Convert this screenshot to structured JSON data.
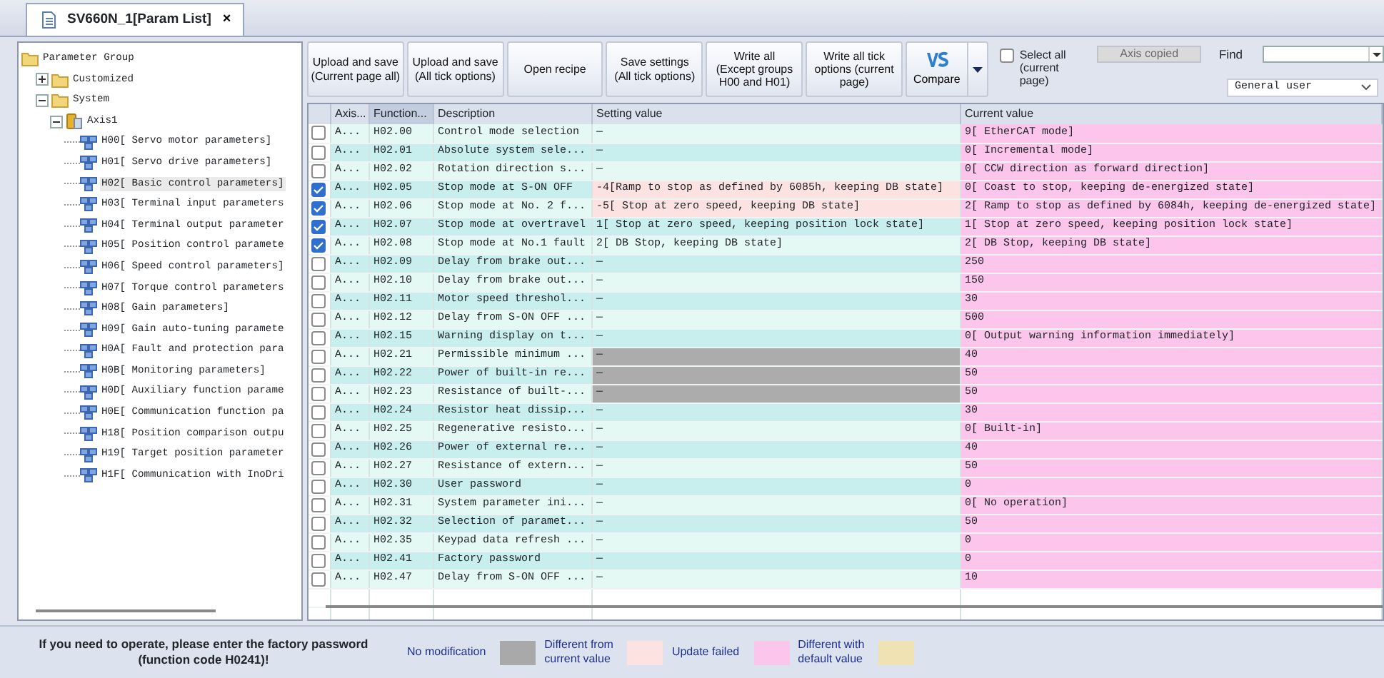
{
  "tab": {
    "title": "SV660N_1[Param List]",
    "close": "×"
  },
  "tree": [
    {
      "label": "Parameter Group",
      "kind": "folder",
      "children": [
        {
          "label": "Customized",
          "kind": "folder",
          "expanded": false
        },
        {
          "label": "System",
          "kind": "folder",
          "expanded": true,
          "children": [
            {
              "label": "Axis1",
              "kind": "axis",
              "expanded": true,
              "children": [
                {
                  "label": "H00[ Servo motor parameters]",
                  "kind": "group",
                  "selected": false
                },
                {
                  "label": "H01[ Servo drive parameters]",
                  "kind": "group",
                  "selected": false
                },
                {
                  "label": "H02[ Basic control parameters]",
                  "kind": "group",
                  "selected": true
                },
                {
                  "label": "H03[ Terminal input parameters",
                  "kind": "group",
                  "selected": false
                },
                {
                  "label": "H04[ Terminal output parameter",
                  "kind": "group",
                  "selected": false
                },
                {
                  "label": "H05[ Position control paramete",
                  "kind": "group",
                  "selected": false
                },
                {
                  "label": "H06[ Speed control parameters]",
                  "kind": "group",
                  "selected": false
                },
                {
                  "label": "H07[ Torque control parameters",
                  "kind": "group",
                  "selected": false
                },
                {
                  "label": "H08[ Gain parameters]",
                  "kind": "group",
                  "selected": false
                },
                {
                  "label": "H09[ Gain auto-tuning paramete",
                  "kind": "group",
                  "selected": false
                },
                {
                  "label": "H0A[ Fault and protection para",
                  "kind": "group",
                  "selected": false
                },
                {
                  "label": "H0B[ Monitoring parameters]",
                  "kind": "group",
                  "selected": false
                },
                {
                  "label": "H0D[ Auxiliary function parame",
                  "kind": "group",
                  "selected": false
                },
                {
                  "label": "H0E[ Communication function pa",
                  "kind": "group",
                  "selected": false
                },
                {
                  "label": "H18[ Position comparison outpu",
                  "kind": "group",
                  "selected": false
                },
                {
                  "label": "H19[ Target position parameter",
                  "kind": "group",
                  "selected": false
                },
                {
                  "label": "H1F[ Communication with InoDri",
                  "kind": "group",
                  "selected": false
                }
              ]
            }
          ]
        }
      ]
    }
  ],
  "toolbar": {
    "buttons": [
      {
        "label": "Upload and save\n(Current page all)",
        "kind": "text"
      },
      {
        "label": "Upload and save\n(All tick options)",
        "kind": "text"
      },
      {
        "label": "Open recipe",
        "kind": "text"
      },
      {
        "label": "Save settings\n(All tick options)",
        "kind": "text"
      },
      {
        "label": "Write all\n(Except groups\nH00 and H01)",
        "kind": "text"
      },
      {
        "label": "Write all tick\noptions (current\npage)",
        "kind": "text"
      },
      {
        "label": "Compare",
        "kind": "compare"
      }
    ],
    "select_all": {
      "label": "Select all\n(current page)",
      "checked": false
    },
    "axis_copied": {
      "label": "Axis copied",
      "disabled": true
    },
    "find_label": "Find",
    "user_level": "General user"
  },
  "table": {
    "columns": [
      {
        "label": "Axis...",
        "selected": false
      },
      {
        "label": "Function...",
        "selected": true
      },
      {
        "label": "Description",
        "selected": false
      },
      {
        "label": "Setting value",
        "selected": false
      },
      {
        "label": "Current value",
        "selected": false
      }
    ],
    "rows": [
      {
        "checked": false,
        "axis": "A...",
        "code": "H02.00",
        "description": "Control mode selection",
        "setting": "—",
        "update_failed": false,
        "differs_from_current": false,
        "current": "9[ EtherCAT mode]",
        "current_differs": true
      },
      {
        "checked": false,
        "axis": "A...",
        "code": "H02.01",
        "description": "Absolute system sele...",
        "setting": "—",
        "update_failed": false,
        "differs_from_current": false,
        "current": "0[ Incremental mode]",
        "current_differs": true
      },
      {
        "checked": false,
        "axis": "A...",
        "code": "H02.02",
        "description": "Rotation direction s...",
        "setting": "—",
        "update_failed": false,
        "differs_from_current": false,
        "current": "0[ CCW direction as forward direction]",
        "current_differs": true
      },
      {
        "checked": true,
        "axis": "A...",
        "code": "H02.05",
        "description": "Stop mode at S-ON OFF",
        "setting": "-4[Ramp to stop as defined by 6085h, keeping DB state]",
        "update_failed": true,
        "differs_from_current": false,
        "current": "0[ Coast to stop, keeping de-energized state]",
        "current_differs": true
      },
      {
        "checked": true,
        "axis": "A...",
        "code": "H02.06",
        "description": "Stop mode at No. 2 f...",
        "setting": "-5[ Stop at zero speed, keeping DB state]",
        "update_failed": true,
        "differs_from_current": false,
        "current": "2[ Ramp to stop as defined by 6084h, keeping de-energized state]",
        "current_differs": true
      },
      {
        "checked": true,
        "axis": "A...",
        "code": "H02.07",
        "description": "Stop mode at overtravel",
        "setting": "1[ Stop at zero speed, keeping position lock state]",
        "update_failed": false,
        "differs_from_current": false,
        "current": "1[ Stop at zero speed, keeping position lock state]",
        "current_differs": true
      },
      {
        "checked": true,
        "axis": "A...",
        "code": "H02.08",
        "description": "Stop mode at No.1 fault",
        "setting": "2[ DB Stop, keeping DB state]",
        "update_failed": false,
        "differs_from_current": false,
        "current": "2[ DB Stop, keeping DB state]",
        "current_differs": true
      },
      {
        "checked": false,
        "axis": "A...",
        "code": "H02.09",
        "description": "Delay from brake out...",
        "setting": "—",
        "update_failed": false,
        "differs_from_current": false,
        "current": "250",
        "current_differs": true
      },
      {
        "checked": false,
        "axis": "A...",
        "code": "H02.10",
        "description": "Delay from brake out...",
        "setting": "—",
        "update_failed": false,
        "differs_from_current": false,
        "current": "150",
        "current_differs": true
      },
      {
        "checked": false,
        "axis": "A...",
        "code": "H02.11",
        "description": "Motor speed threshol...",
        "setting": "—",
        "update_failed": false,
        "differs_from_current": false,
        "current": "30",
        "current_differs": true
      },
      {
        "checked": false,
        "axis": "A...",
        "code": "H02.12",
        "description": "Delay from S-ON OFF ...",
        "setting": "—",
        "update_failed": false,
        "differs_from_current": false,
        "current": "500",
        "current_differs": true
      },
      {
        "checked": false,
        "axis": "A...",
        "code": "H02.15",
        "description": "Warning display on t...",
        "setting": "—",
        "update_failed": false,
        "differs_from_current": false,
        "current": "0[ Output warning information immediately]",
        "current_differs": true
      },
      {
        "checked": false,
        "axis": "A...",
        "code": "H02.21",
        "description": "Permissible minimum ...",
        "setting": "—",
        "update_failed": false,
        "differs_from_current": true,
        "current": "40",
        "current_differs": true
      },
      {
        "checked": false,
        "axis": "A...",
        "code": "H02.22",
        "description": "Power of built-in re...",
        "setting": "—",
        "update_failed": false,
        "differs_from_current": true,
        "current": "50",
        "current_differs": true
      },
      {
        "checked": false,
        "axis": "A...",
        "code": "H02.23",
        "description": "Resistance of built-...",
        "setting": "—",
        "update_failed": false,
        "differs_from_current": true,
        "current": "50",
        "current_differs": true
      },
      {
        "checked": false,
        "axis": "A...",
        "code": "H02.24",
        "description": "Resistor heat dissip...",
        "setting": "—",
        "update_failed": false,
        "differs_from_current": false,
        "current": "30",
        "current_differs": true
      },
      {
        "checked": false,
        "axis": "A...",
        "code": "H02.25",
        "description": "Regenerative resisto...",
        "setting": "—",
        "update_failed": false,
        "differs_from_current": false,
        "current": "0[ Built-in]",
        "current_differs": true
      },
      {
        "checked": false,
        "axis": "A...",
        "code": "H02.26",
        "description": "Power of external re...",
        "setting": "—",
        "update_failed": false,
        "differs_from_current": false,
        "current": "40",
        "current_differs": true
      },
      {
        "checked": false,
        "axis": "A...",
        "code": "H02.27",
        "description": "Resistance of extern...",
        "setting": "—",
        "update_failed": false,
        "differs_from_current": false,
        "current": "50",
        "current_differs": true
      },
      {
        "checked": false,
        "axis": "A...",
        "code": "H02.30",
        "description": "User password",
        "setting": "—",
        "update_failed": false,
        "differs_from_current": false,
        "current": "0",
        "current_differs": true
      },
      {
        "checked": false,
        "axis": "A...",
        "code": "H02.31",
        "description": "System parameter ini...",
        "setting": "—",
        "update_failed": false,
        "differs_from_current": false,
        "current": "0[ No operation]",
        "current_differs": true
      },
      {
        "checked": false,
        "axis": "A...",
        "code": "H02.32",
        "description": "Selection of paramet...",
        "setting": "—",
        "update_failed": false,
        "differs_from_current": false,
        "current": "50",
        "current_differs": true
      },
      {
        "checked": false,
        "axis": "A...",
        "code": "H02.35",
        "description": "Keypad data refresh ...",
        "setting": "—",
        "update_failed": false,
        "differs_from_current": false,
        "current": "0",
        "current_differs": true
      },
      {
        "checked": false,
        "axis": "A...",
        "code": "H02.41",
        "description": "Factory password",
        "setting": "—",
        "update_failed": false,
        "differs_from_current": false,
        "current": "0",
        "current_differs": true
      },
      {
        "checked": false,
        "axis": "A...",
        "code": "H02.47",
        "description": "Delay from S-ON OFF ...",
        "setting": "—",
        "update_failed": false,
        "differs_from_current": false,
        "current": "10",
        "current_differs": true
      }
    ]
  },
  "footer": {
    "message": "If you need to operate, please enter the factory password\n(function code H0241)!",
    "legend": [
      {
        "label": "No modification"
      },
      {
        "label": "Different from\ncurrent value",
        "color": "#a9a9a9"
      },
      {
        "label": "Update failed",
        "color": "#fde2e2"
      },
      {
        "label": "Different with\ndefault value",
        "color": "#fcc6ec"
      },
      {
        "color": "#efe3b3"
      }
    ]
  }
}
